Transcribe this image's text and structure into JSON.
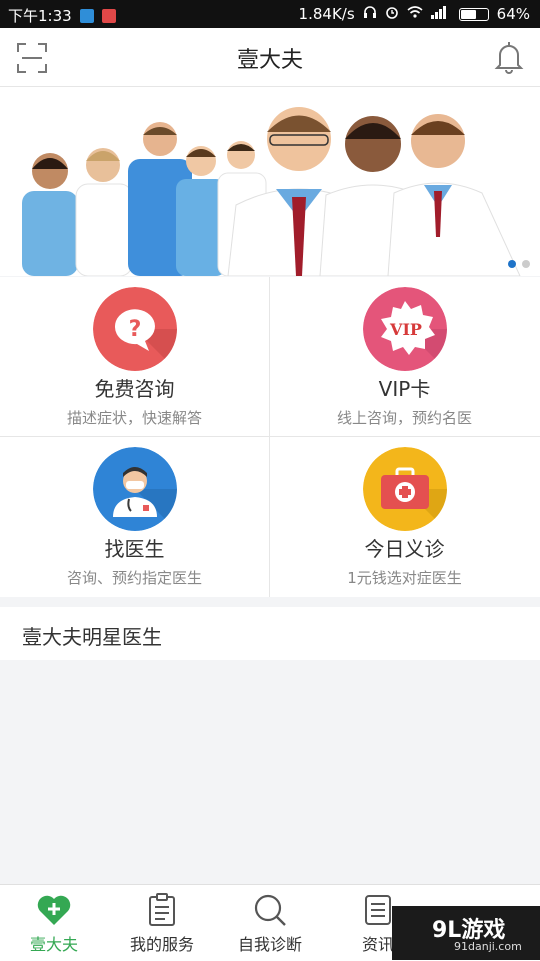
{
  "status_bar": {
    "time": "下午1:33",
    "network_speed": "1.84K/s",
    "battery_percent": "64%",
    "battery_level": 0.64
  },
  "header": {
    "title": "壹大夫",
    "left_icon": "scan-icon",
    "right_icon": "bell-icon"
  },
  "banner": {
    "slides": 2,
    "active_slide": 1
  },
  "services": [
    {
      "title": "免费咨询",
      "subtitle": "描述症状，快速解答",
      "icon": "question-bubble-icon",
      "color": "#e85a5a"
    },
    {
      "title": "VIP卡",
      "subtitle": "线上咨询，预约名医",
      "icon": "vip-badge-icon",
      "color": "#e4557a"
    },
    {
      "title": "找医生",
      "subtitle": "咨询、预约指定医生",
      "icon": "doctor-icon",
      "color": "#2f84d6"
    },
    {
      "title": "今日义诊",
      "subtitle": "1元钱选对症医生",
      "icon": "medical-kit-icon",
      "color": "#f3b61b"
    }
  ],
  "section": {
    "title": "壹大夫明星医生"
  },
  "bottom_nav": [
    {
      "label": "壹大夫",
      "icon": "heart-plus-icon",
      "active": true
    },
    {
      "label": "我的服务",
      "icon": "clipboard-icon",
      "active": false
    },
    {
      "label": "自我诊断",
      "icon": "search-icon",
      "active": false
    },
    {
      "label": "资讯",
      "icon": "news-icon",
      "active": false
    }
  ],
  "watermark": {
    "logo": "9L游戏",
    "url": "91danji.com"
  },
  "colors": {
    "accent_green": "#34a853",
    "banner_dot_active": "#1e73c8"
  }
}
